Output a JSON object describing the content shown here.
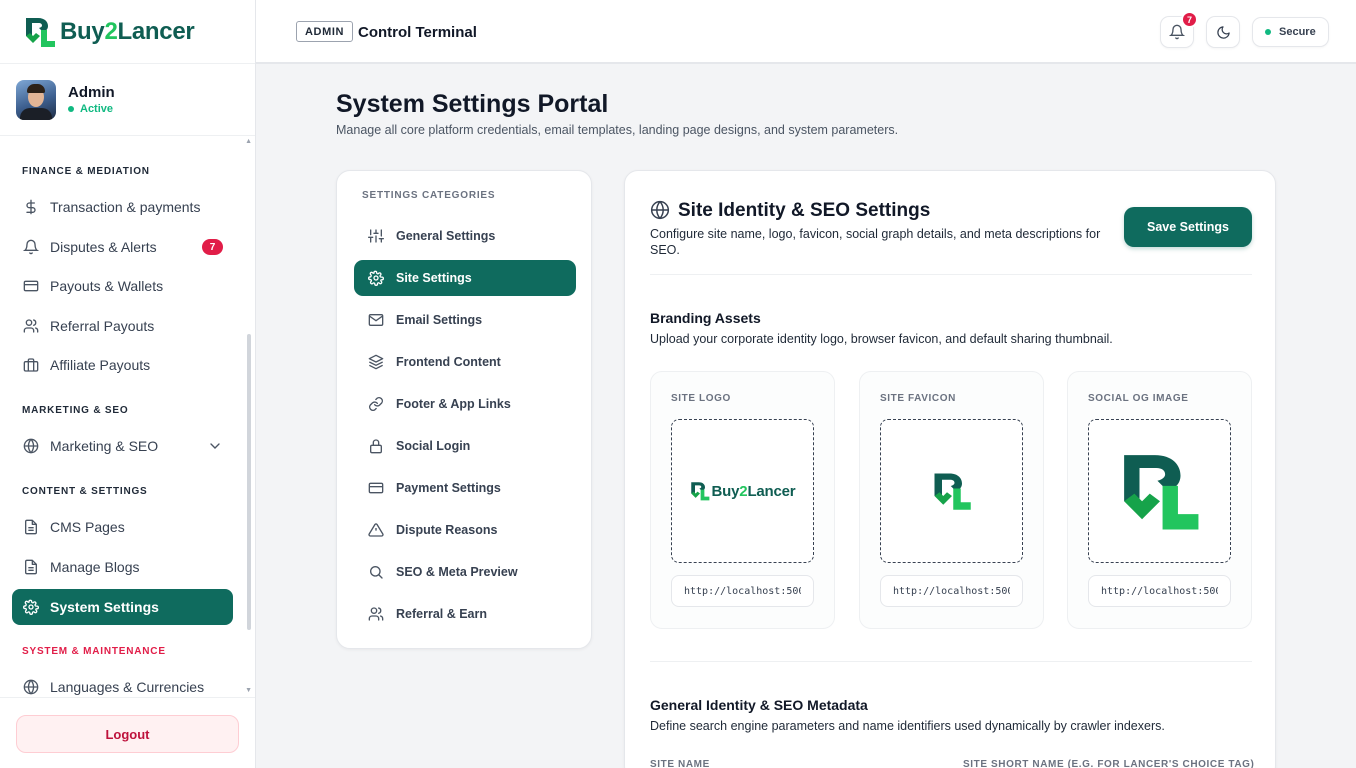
{
  "brand": {
    "name_main": "Buy",
    "name_accent": "2",
    "name_end": "Lancer"
  },
  "user": {
    "name": "Admin",
    "status": "Active"
  },
  "sidebar": {
    "sections": {
      "finance": "FINANCE & MEDIATION",
      "marketing": "MARKETING & SEO",
      "content": "CONTENT & SETTINGS",
      "system": "SYSTEM & MAINTENANCE"
    },
    "items": [
      {
        "label": "Transaction & payments",
        "icon": "dollar-icon"
      },
      {
        "label": "Disputes & Alerts",
        "icon": "bell-icon",
        "badge": "7"
      },
      {
        "label": "Payouts & Wallets",
        "icon": "card-icon"
      },
      {
        "label": "Referral Payouts",
        "icon": "users-icon"
      },
      {
        "label": "Affiliate Payouts",
        "icon": "briefcase-icon"
      },
      {
        "label": "Marketing & SEO",
        "icon": "globe-icon"
      },
      {
        "label": "CMS Pages",
        "icon": "file-icon"
      },
      {
        "label": "Manage Blogs",
        "icon": "file-icon"
      },
      {
        "label": "System Settings",
        "icon": "gear-icon"
      },
      {
        "label": "Languages & Currencies",
        "icon": "globe-icon"
      }
    ],
    "logout": "Logout"
  },
  "topbar": {
    "tag": "ADMIN",
    "title": "Control Terminal",
    "notifications": "7",
    "secure": "Secure"
  },
  "page": {
    "title": "System Settings Portal",
    "subtitle": "Manage all core platform credentials, email templates, landing page designs, and system parameters."
  },
  "categories": {
    "header": "SETTINGS CATEGORIES",
    "items": [
      {
        "label": "General Settings",
        "icon": "sliders-icon"
      },
      {
        "label": "Site Settings",
        "icon": "gear-icon"
      },
      {
        "label": "Email Settings",
        "icon": "mail-icon"
      },
      {
        "label": "Frontend Content",
        "icon": "layers-icon"
      },
      {
        "label": "Footer & App Links",
        "icon": "link-icon"
      },
      {
        "label": "Social Login",
        "icon": "lock-icon"
      },
      {
        "label": "Payment Settings",
        "icon": "card-icon"
      },
      {
        "label": "Dispute Reasons",
        "icon": "alert-triangle-icon"
      },
      {
        "label": "SEO & Meta Preview",
        "icon": "search-icon"
      },
      {
        "label": "Referral & Earn",
        "icon": "users-icon"
      }
    ]
  },
  "content": {
    "title": "Site Identity & SEO Settings",
    "description": "Configure site name, logo, favicon, social graph details, and meta descriptions for SEO.",
    "save": "Save Settings",
    "branding": {
      "title": "Branding Assets",
      "description": "Upload your corporate identity logo, browser favicon, and default sharing thumbnail.",
      "assets": [
        {
          "label": "SITE LOGO",
          "url": "http://localhost:5000/uploads/logo.png"
        },
        {
          "label": "SITE FAVICON",
          "url": "http://localhost:5000/uploads/favicon.png"
        },
        {
          "label": "SOCIAL OG IMAGE",
          "url": "http://localhost:5000/uploads/og-image.png"
        }
      ]
    },
    "identity": {
      "title": "General Identity & SEO Metadata",
      "description": "Define search engine parameters and name identifiers used dynamically by crawler indexers.",
      "site_name_label": "SITE NAME",
      "site_short_label": "SITE SHORT NAME (E.G. FOR LANCER'S CHOICE TAG)"
    }
  },
  "colors": {
    "primary": "#0f6b5e",
    "accent": "#22c55e",
    "danger": "#e11d48",
    "success": "#10b981"
  }
}
